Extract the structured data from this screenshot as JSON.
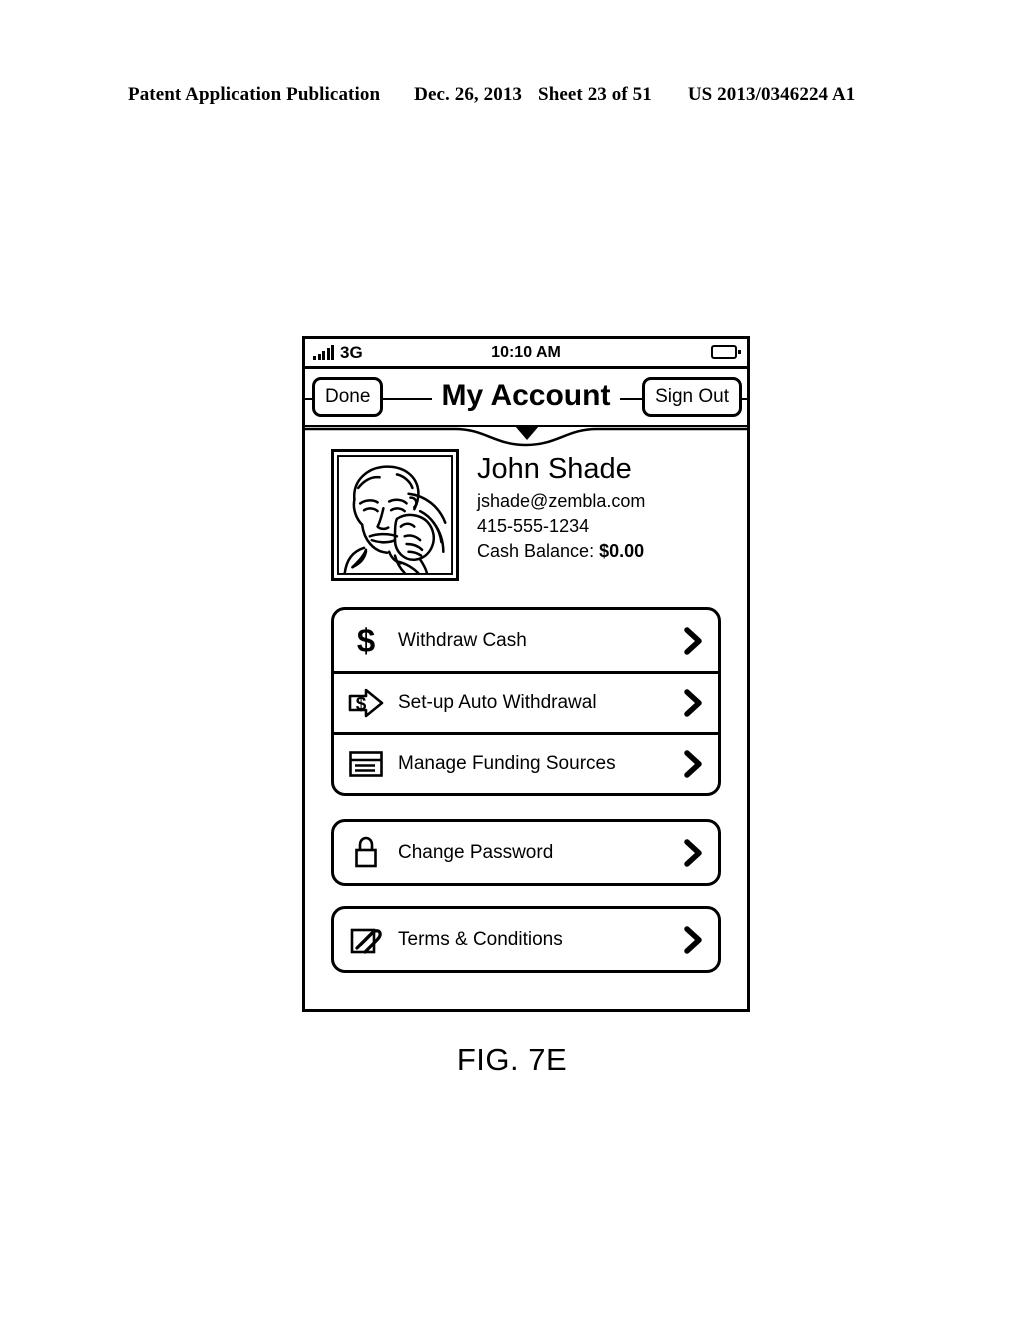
{
  "patent_header": {
    "publication": "Patent Application Publication",
    "date": "Dec. 26, 2013",
    "sheet": "Sheet 23 of 51",
    "number": "US 2013/0346224 A1"
  },
  "figure": {
    "caption": "FIG. 7E"
  },
  "phone": {
    "status_bar": {
      "signal_icon": "signal-bars-icon",
      "carrier": "3G",
      "time": "10:10 AM",
      "battery_icon": "battery-icon"
    },
    "nav_bar": {
      "back_label": "Done",
      "title": "My Account",
      "action_label": "Sign Out",
      "dropdown_icon": "triangle-down-icon"
    },
    "profile": {
      "avatar_icon": "user-photo-boxer",
      "name": "John Shade",
      "email": "jshade@zembla.com",
      "phone": "415-555-1234",
      "balance_label": "Cash Balance:",
      "balance_value": "$0.00"
    },
    "menu_groups": [
      {
        "items": [
          {
            "icon": "dollar-sign-icon",
            "label": "Withdraw Cash",
            "chevron": "chevron-right-icon"
          },
          {
            "icon": "dollar-arrow-icon",
            "label": "Set-up Auto Withdrawal",
            "chevron": "chevron-right-icon"
          },
          {
            "icon": "funding-card-icon",
            "label": "Manage Funding Sources",
            "chevron": "chevron-right-icon"
          }
        ]
      },
      {
        "items": [
          {
            "icon": "padlock-icon",
            "label": "Change Password",
            "chevron": "chevron-right-icon"
          }
        ]
      },
      {
        "items": [
          {
            "icon": "document-paperclip-icon",
            "label": "Terms & Conditions",
            "chevron": "chevron-right-icon"
          }
        ]
      }
    ]
  },
  "colors": {
    "ink": "#000000",
    "paper": "#ffffff"
  }
}
